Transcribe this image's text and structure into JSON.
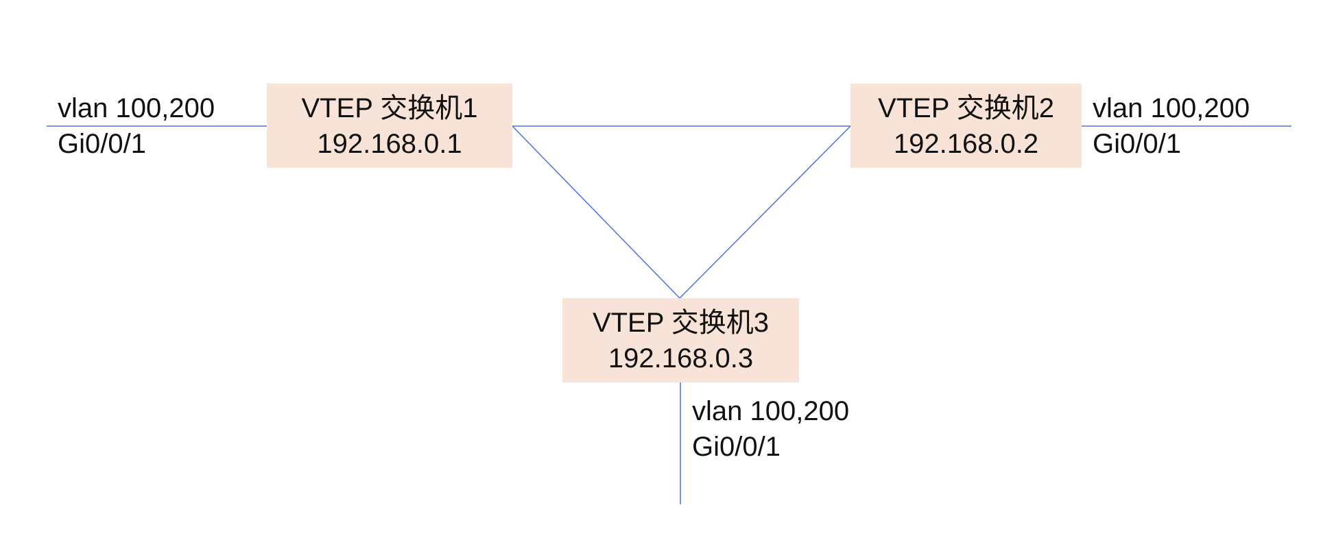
{
  "colors": {
    "box_fill": "#f7e3d7",
    "link": "#4a6fe3",
    "text": "#111111"
  },
  "nodes": [
    {
      "name": "VTEP 交换机1",
      "ip": "192.168.0.1"
    },
    {
      "name": "VTEP 交换机2",
      "ip": "192.168.0.2"
    },
    {
      "name": "VTEP 交换机3",
      "ip": "192.168.0.3"
    }
  ],
  "ports": [
    {
      "vlan": "vlan 100,200",
      "iface": "Gi0/0/1"
    },
    {
      "vlan": "vlan 100,200",
      "iface": "Gi0/0/1"
    },
    {
      "vlan": "vlan 100,200",
      "iface": "Gi0/0/1"
    }
  ]
}
